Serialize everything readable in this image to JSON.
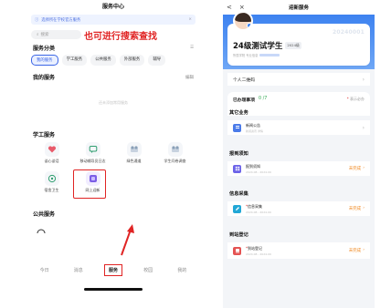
{
  "left": {
    "title": "服务中心",
    "notice": "选择所在学校官方服务",
    "notice_close": "×",
    "search_placeholder": "搜索",
    "search_annotation": "也可进行搜索查找",
    "category_title": "服务分类",
    "category_chips": [
      "我的服务",
      "学工服务",
      "公共服务",
      "外部服务",
      "辅导"
    ],
    "my_services_title": "我的服务",
    "my_services_edit": "编辑",
    "my_services_empty": "还未添加常用服务",
    "xg_title": "学工服务",
    "xg_tiles": [
      {
        "label": "谈心谈话",
        "icon": "heart-icon",
        "color": "#e85a6a"
      },
      {
        "label": "移动辅导员日志",
        "icon": "chat-icon",
        "color": "#2f9e6f"
      },
      {
        "label": "绿色通道",
        "icon": "path-icon",
        "color": "#8aa0b8"
      },
      {
        "label": "学生问卷调查",
        "icon": "survey-icon",
        "color": "#8aa0b8"
      },
      {
        "label": "宿舍卫生",
        "icon": "home-icon",
        "color": "#2f9e6f"
      },
      {
        "label": "网上迎新",
        "icon": "welcome-icon",
        "color": "#7b5de6"
      }
    ],
    "public_title": "公共服务",
    "tabs": [
      "今日",
      "消息",
      "服务",
      "校园",
      "我的"
    ],
    "active_tab": "服务"
  },
  "right": {
    "nav_title": "迎新服务",
    "back_glyph": "<",
    "close_glyph": "×",
    "profile_id": "20240001",
    "profile_name": "24级测试学生",
    "profile_badge": "2024级",
    "profile_line": "所属学院  专业信息",
    "qr_label": "个人二维码",
    "todo_label": "已办理事项",
    "todo_count": "0 /7",
    "todo_hint": "表示必办",
    "groups": [
      {
        "title": "其它业务",
        "items": [
          {
            "name": "新闻公告",
            "sub": "新闻资讯 详情",
            "status": "",
            "icon_color": "#4b7be9",
            "required": false
          }
        ]
      },
      {
        "title": "报到须知",
        "items": [
          {
            "name": "报到须知",
            "sub": "2024.08 - 2024.09",
            "status": "未完成",
            "icon_color": "#6c63e8",
            "required": false
          }
        ]
      },
      {
        "title": "信息采集",
        "items": [
          {
            "name": "信息采集",
            "sub": "2024.08 - 2024.09",
            "status": "未完成",
            "icon_color": "#22a7d6",
            "required": true
          }
        ]
      },
      {
        "title": "到站登记",
        "items": [
          {
            "name": "到站登记",
            "sub": "2024.08 - 2024.09",
            "status": "未完成",
            "icon_color": "#e45353",
            "required": true
          }
        ]
      }
    ]
  },
  "colors": {
    "accent": "#3c66e6",
    "annotation": "#e02424",
    "pending": "#f08a24"
  }
}
